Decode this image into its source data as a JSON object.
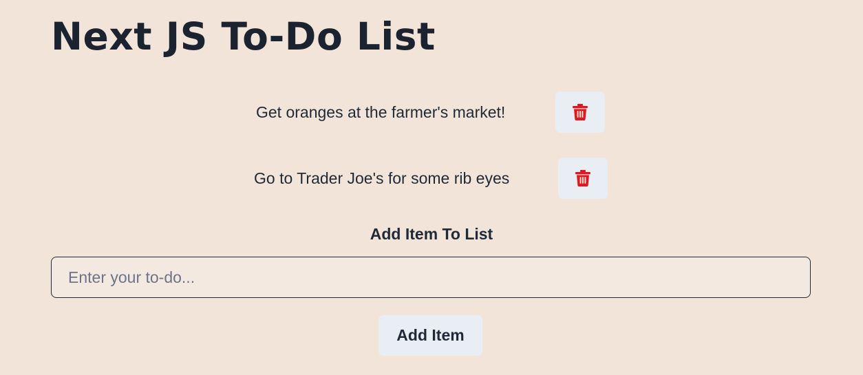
{
  "header": {
    "title": "Next JS To-Do List"
  },
  "todos": [
    {
      "text": "Get oranges at the farmer's market!",
      "delete_icon": "trash-icon"
    },
    {
      "text": "Go to Trader Joe's for some rib eyes",
      "delete_icon": "trash-icon"
    }
  ],
  "add_form": {
    "heading": "Add Item To List",
    "input_placeholder": "Enter your to-do...",
    "input_value": "",
    "button_label": "Add Item"
  },
  "colors": {
    "background": "#f2e4d9",
    "button_bg": "#e9edf4",
    "delete_icon": "#e3151d",
    "text": "#1f2937"
  }
}
